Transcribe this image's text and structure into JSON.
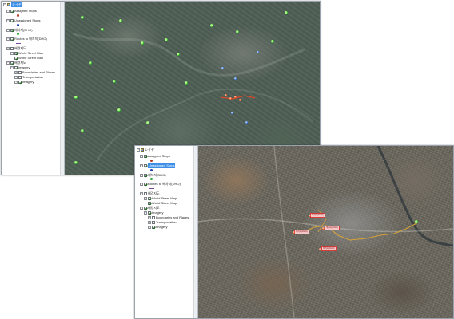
{
  "screens": [
    {
      "toc": {
        "root_label": "レイヤ",
        "items": [
          {
            "label": "Assigned Stops",
            "checked": true
          },
          {
            "label": "Unassigned Stops",
            "checked": true
          },
          {
            "label": "배차지(DHO)",
            "checked": true
          },
          {
            "label": "Routes to 배차지(DHO)",
            "checked": true
          },
          {
            "label": "배경지도",
            "checked": false
          },
          {
            "label": "World Street Map",
            "checked": true
          },
          {
            "label": "World Street Map",
            "checked": true
          },
          {
            "label": "배경지도",
            "checked": true
          },
          {
            "label": "Imagery",
            "checked": true
          },
          {
            "label": "Boundaries and Places",
            "checked": false
          },
          {
            "label": "Transportation",
            "checked": false
          },
          {
            "label": "Imagery",
            "checked": true
          }
        ]
      },
      "map": {
        "basemap": "imagery",
        "tone": "#4f5f55"
      }
    },
    {
      "toc": {
        "root_label": "レイヤ",
        "items": [
          {
            "label": "Assigned Stops",
            "checked": true
          },
          {
            "label": "Unassigned Stops",
            "checked": true,
            "selected": true
          },
          {
            "label": "배차지(DHO)",
            "checked": true
          },
          {
            "label": "Routes to 배차지(DHO)",
            "checked": true
          },
          {
            "label": "배경지도",
            "checked": false
          },
          {
            "label": "World Street Map",
            "checked": true
          },
          {
            "label": "World Street Map",
            "checked": true
          },
          {
            "label": "배경지도",
            "checked": true
          },
          {
            "label": "Imagery",
            "checked": true
          },
          {
            "label": "Boundaries and Places",
            "checked": false
          },
          {
            "label": "Transportation",
            "checked": false
          },
          {
            "label": "Imagery",
            "checked": true
          }
        ]
      },
      "map": {
        "basemap": "imagery",
        "tone": "#6e6a60",
        "labels": [
          "배차지(DHO)",
          "배차지(DHO)",
          "배차지(DHO)",
          "배차지(DHO)"
        ]
      }
    }
  ],
  "colors": {
    "assigned_stop": "#b13a1e",
    "unassigned_stop": "#1a3fae",
    "depot": "#2fa82f",
    "route": "#7a4a9a",
    "route_line_map": "#d6a23a",
    "selection": "#3d8ee6"
  }
}
